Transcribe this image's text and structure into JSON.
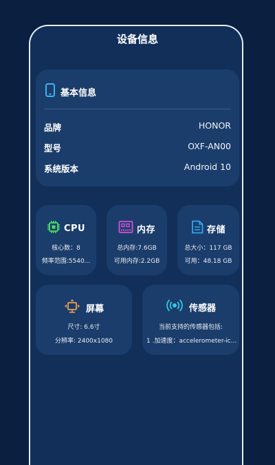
{
  "page": {
    "title": "设备信息"
  },
  "basic": {
    "header": "基本信息",
    "rows": [
      {
        "label": "品牌",
        "value": "HONOR"
      },
      {
        "label": "型号",
        "value": "OXF-AN00"
      },
      {
        "label": "系统版本",
        "value": "Android 10"
      }
    ]
  },
  "cpu": {
    "title": "CPU",
    "line1": "核心数：8",
    "line2": "频率范围:5540..."
  },
  "memory": {
    "title": "内存",
    "line1": "总内存:7.6GB",
    "line2": "可用内存:2.2GB"
  },
  "storage": {
    "title": "存储",
    "line1": "总大小：117 GB",
    "line2": "可用：48.18 GB"
  },
  "screen": {
    "title": "屏幕",
    "line1": "尺寸: 6.6寸",
    "line2": "分辨率: 2400x1080"
  },
  "sensor": {
    "title": "传感器",
    "line1": "当前支持的传感器包括:",
    "line2": "1 .加速度：accelerometer-ic..."
  },
  "colors": {
    "background": "#0b2040",
    "panel": "#112f59",
    "card": "#1b3d6b",
    "phone_icon": "#3fb4f0",
    "cpu_icon": "#49e06a",
    "memory_icon": "#d64fd6",
    "storage_icon": "#2ea7ee",
    "screen_icon": "#f0a050",
    "sensor_icon": "#35c8e8"
  },
  "icons": [
    "phone-icon",
    "chip-icon",
    "memory-icon",
    "file-icon",
    "screen-icon",
    "sensor-icon"
  ]
}
